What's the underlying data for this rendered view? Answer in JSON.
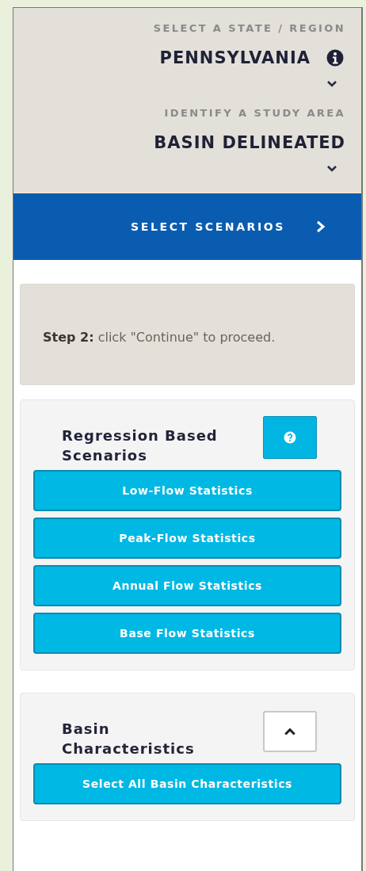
{
  "state_selector": {
    "label": "SELECT A STATE / REGION",
    "value": "PENNSYLVANIA"
  },
  "study_area": {
    "label": "IDENTIFY A STUDY AREA",
    "value": "BASIN DELINEATED"
  },
  "next_step": {
    "label": "SELECT SCENARIOS"
  },
  "instruction": "**Step 2:** click \"Continue\" to proceed.",
  "panels": [
    {
      "title": "Regression Based Scenarios",
      "kind": "help",
      "buttons": [
        "Low-Flow Statistics",
        "Peak-Flow Statistics",
        "Annual Flow Statistics",
        "Base Flow Statistics"
      ]
    },
    {
      "title": "Basin Characteristics",
      "kind": "collapse",
      "expanded": true,
      "buttons": [
        "Select All Basin Characteristics"
      ]
    }
  ]
}
